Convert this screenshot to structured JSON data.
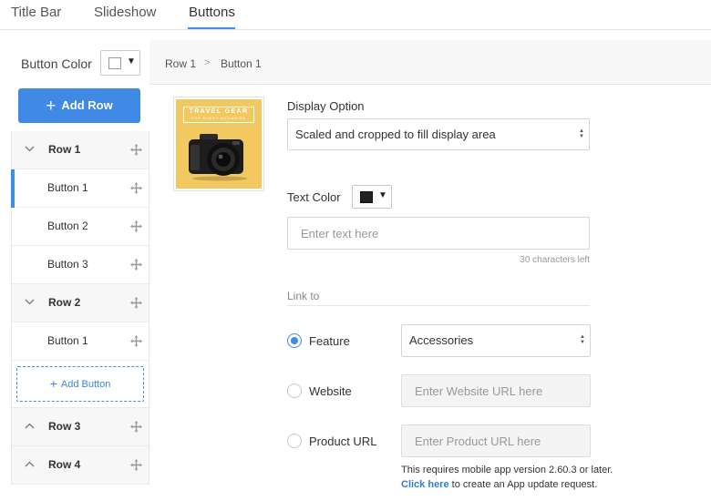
{
  "tabs": [
    {
      "label": "Title Bar"
    },
    {
      "label": "Slideshow"
    },
    {
      "label": "Buttons",
      "active": true
    }
  ],
  "left": {
    "button_color_label": "Button Color",
    "add_row_label": "Add Row",
    "add_button_label": "Add Button",
    "tree": [
      {
        "kind": "row",
        "label": "Row 1",
        "expanded": true
      },
      {
        "kind": "button",
        "label": "Button 1",
        "selected": true
      },
      {
        "kind": "button",
        "label": "Button 2"
      },
      {
        "kind": "button",
        "label": "Button 3"
      },
      {
        "kind": "row",
        "label": "Row 2",
        "expanded": true
      },
      {
        "kind": "button",
        "label": "Button 1"
      },
      {
        "kind": "row",
        "label": "Row 3",
        "expanded": false
      },
      {
        "kind": "row",
        "label": "Row 4",
        "expanded": false
      }
    ]
  },
  "breadcrumb": {
    "row": "Row 1",
    "separator": ">",
    "button": "Button 1"
  },
  "image": {
    "banner_line1": "TRAVEL GEAR",
    "banner_line2": "FOR EVERY OCCASION"
  },
  "form": {
    "display_option_label": "Display Option",
    "display_option_value": "Scaled and cropped to fill display area",
    "text_color_label": "Text Color",
    "text_placeholder": "Enter text here",
    "chars_left": "30 characters left",
    "link_to_label": "Link to",
    "feature_label": "Feature",
    "feature_value": "Accessories",
    "website_label": "Website",
    "website_placeholder": "Enter Website URL here",
    "product_label": "Product URL",
    "product_placeholder": "Enter Product URL here",
    "note_line1": "This requires mobile app version 2.60.3 or later.",
    "note_link": "Click here",
    "note_rest": " to create an App update request."
  },
  "colors": {
    "accent": "#4089e4",
    "button_color_swatch": "#ffffff",
    "text_color_swatch": "#222222"
  }
}
